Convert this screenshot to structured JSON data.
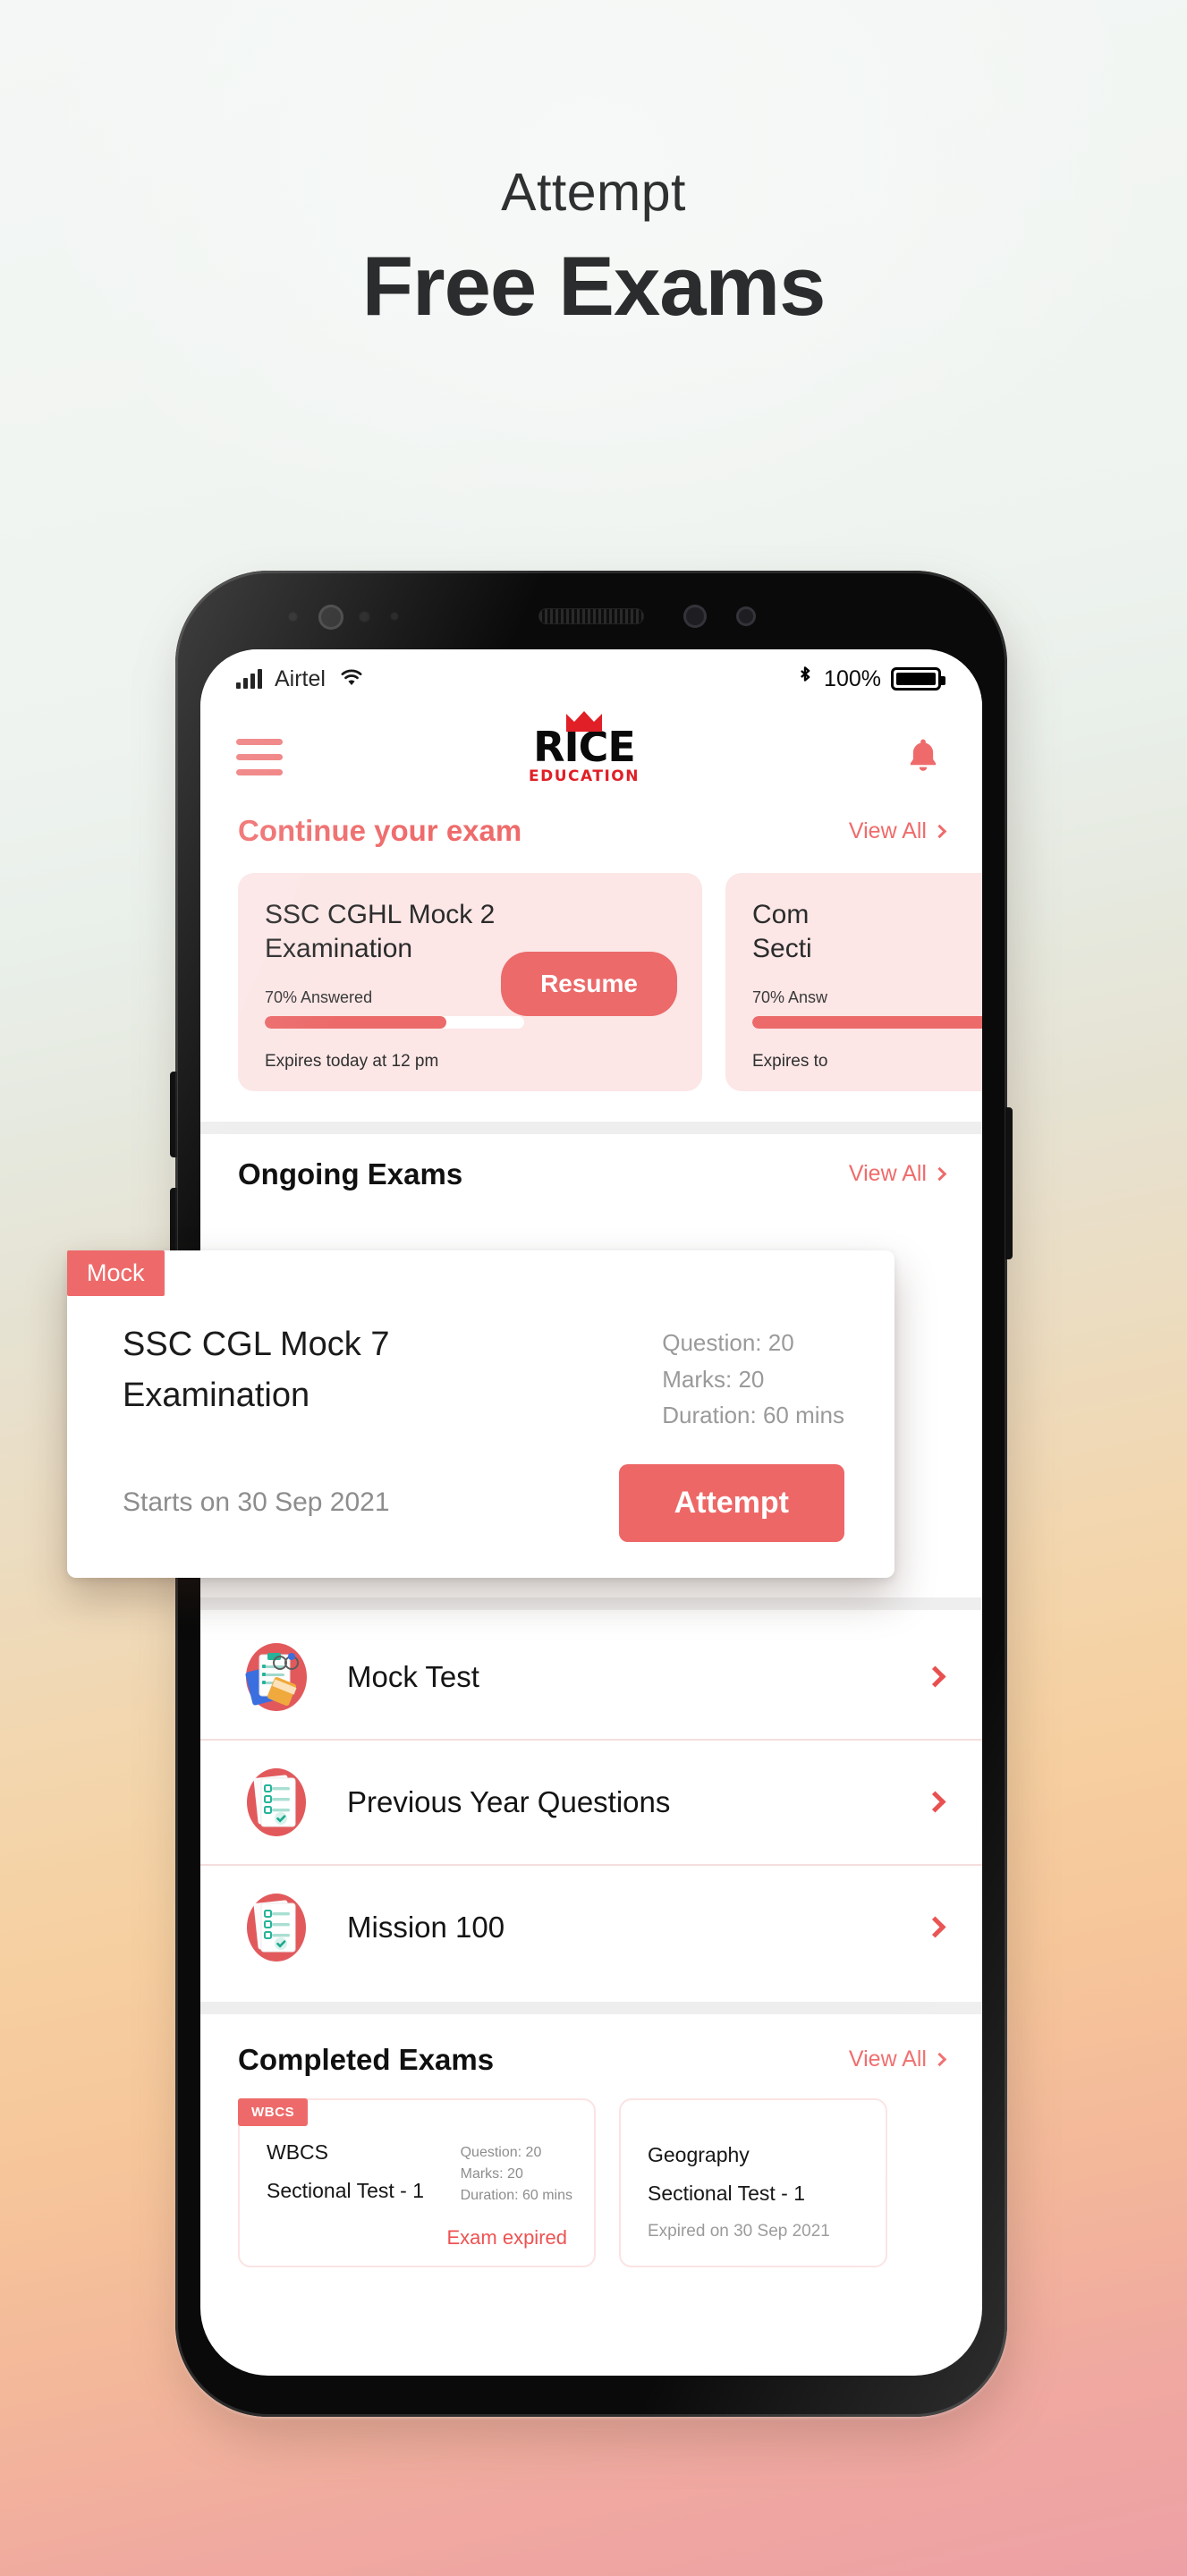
{
  "promo": {
    "line1": "Attempt",
    "line2": "Free Exams"
  },
  "statusbar": {
    "carrier": "Airtel",
    "signal_icon": "signal-bars-icon",
    "wifi_icon": "wifi-icon",
    "bluetooth_icon": "bluetooth-icon",
    "battery_percent": "100%",
    "battery_icon": "battery-full-icon"
  },
  "appbar": {
    "menu_icon": "hamburger-menu-icon",
    "logo_main": "RICE",
    "logo_sub": "EDUCATION",
    "logo_crown_icon": "crown-icon",
    "bell_icon": "notification-bell-icon"
  },
  "continue_section": {
    "title": "Continue your exam",
    "view_all": "View All",
    "cards": [
      {
        "title": "SSC CGHL Mock 2\nExamination",
        "title_line1": "SSC CGHL Mock 2",
        "title_line2": "Examination",
        "answered": "70% Answered",
        "progress": 70,
        "expires": "Expires today at 12 pm",
        "action": "Resume"
      },
      {
        "title_line1": "Com",
        "title_line2": "Secti",
        "answered": "70% Answ",
        "progress": 70,
        "expires": "Expires to"
      }
    ]
  },
  "ongoing_section": {
    "title": "Ongoing Exams",
    "view_all": "View All"
  },
  "highlight_card": {
    "badge": "Mock",
    "title_line1": "SSC CGL Mock 7",
    "title_line2": "Examination",
    "question": "Question: 20",
    "marks": "Marks: 20",
    "duration": "Duration: 60 mins",
    "starts": "Starts on 30 Sep 2021",
    "action": "Attempt"
  },
  "menu_items": [
    {
      "label": "Mock Test",
      "icon": "mock-test-icon",
      "chevron": "chevron-right-icon"
    },
    {
      "label": "Previous Year Questions",
      "icon": "previous-year-questions-icon",
      "chevron": "chevron-right-icon"
    },
    {
      "label": "Mission 100",
      "icon": "mission-100-icon",
      "chevron": "chevron-right-icon"
    }
  ],
  "completed_section": {
    "title": "Completed Exams",
    "view_all": "View All",
    "cards": [
      {
        "badge": "WBCS",
        "line1": "WBCS",
        "line2": "Sectional Test - 1",
        "question": "Question: 20",
        "marks": "Marks: 20",
        "duration": "Duration: 60 mins",
        "status": "Exam expired"
      },
      {
        "line1": "Geography",
        "line2": "Sectional Test - 1",
        "status": "Expired on 30 Sep 2021"
      }
    ]
  },
  "colors": {
    "accent": "#ee6a6a",
    "accent_dark": "#e8504f",
    "logo_red": "#e01f26",
    "card_pink": "#fce6e6",
    "muted": "#9a9a9a"
  }
}
